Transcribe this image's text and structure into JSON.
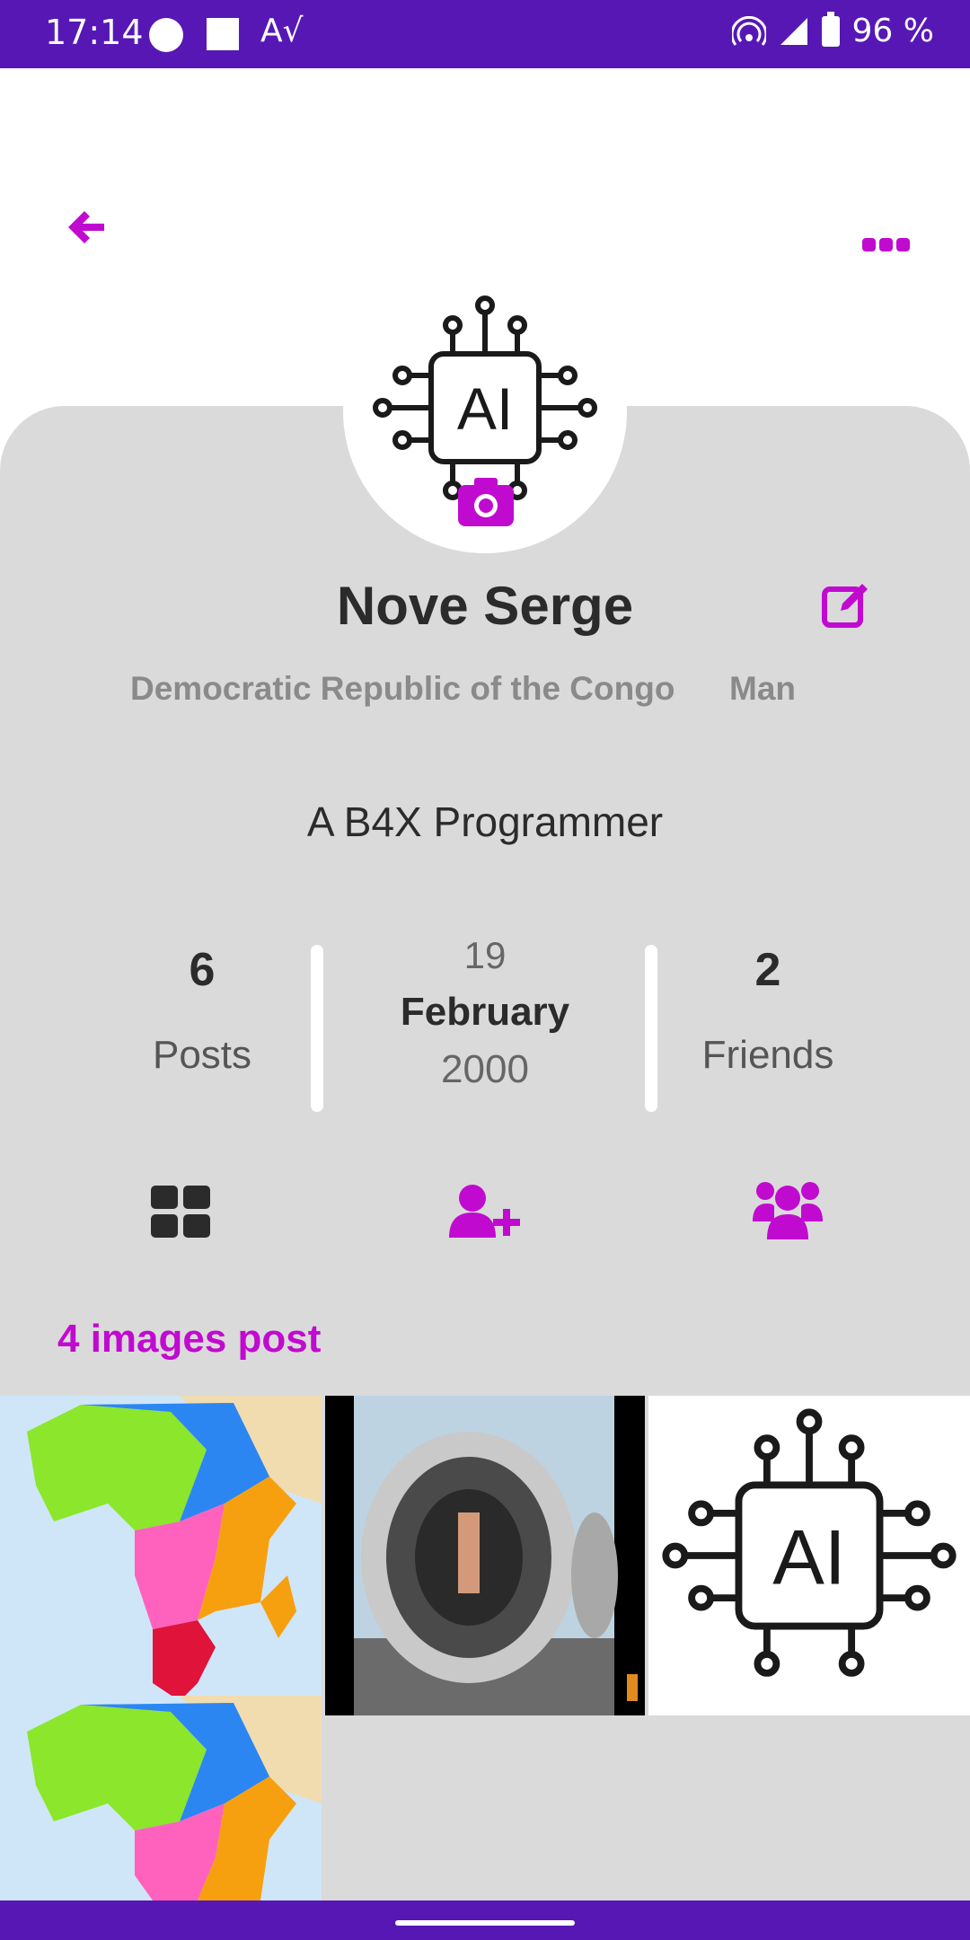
{
  "status_bar": {
    "time": "17:14",
    "a_icon": "A√",
    "battery": "96 %"
  },
  "profile": {
    "name": "Nove Serge",
    "country": "Democratic Republic of the Congo",
    "gender": "Man",
    "bio": "A B4X Programmer",
    "avatar_text": "AI"
  },
  "stats": {
    "posts_count": "6",
    "posts_label": "Posts",
    "birth_day": "19",
    "birth_month": "February",
    "birth_year": "2000",
    "friends_count": "2",
    "friends_label": "Friends"
  },
  "posts_section": {
    "title": "4 images post",
    "images": [
      {
        "subject": "map of Africa"
      },
      {
        "subject": "man standing inside jet engine"
      },
      {
        "subject": "AI chip logo",
        "text": "AI"
      },
      {
        "subject": "map of Africa"
      }
    ]
  },
  "colors": {
    "accent": "#c10ad0",
    "status_bar": "#5717b5",
    "panel": "#dadada",
    "text": "#2b2b2b"
  },
  "icons": [
    "back-arrow-icon",
    "more-dots-icon",
    "camera-icon",
    "edit-icon",
    "grid-icon",
    "add-friend-icon",
    "friends-group-icon"
  ]
}
